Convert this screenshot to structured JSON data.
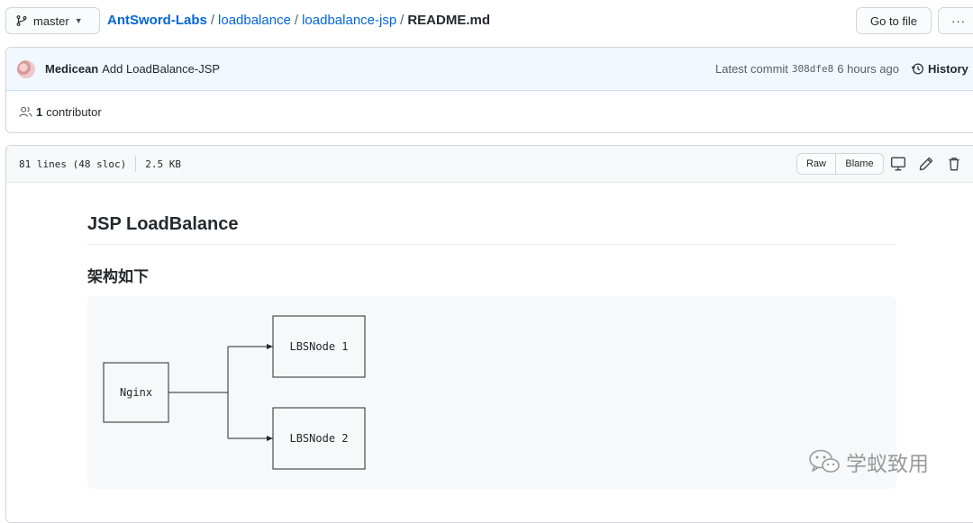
{
  "topbar": {
    "branch": "master",
    "breadcrumb": {
      "owner": "AntSword-Labs",
      "sep1": "/",
      "repo": "loadbalance",
      "sep2": "/",
      "folder": "loadbalance-jsp",
      "sep3": "/",
      "file": "README.md"
    },
    "goto_file": "Go to file",
    "more": "···"
  },
  "commit": {
    "author": "Medicean",
    "message": "Add LoadBalance-JSP",
    "latest_label": "Latest commit",
    "sha": "308dfe8",
    "time": "6 hours ago",
    "history": "History"
  },
  "contributors": {
    "count": "1",
    "label": "contributor"
  },
  "file": {
    "lines": "81 lines (48 sloc)",
    "size": "2.5 KB",
    "raw": "Raw",
    "blame": "Blame"
  },
  "readme": {
    "title": "JSP LoadBalance",
    "subtitle": "架构如下",
    "diagram": {
      "nginx": "Nginx",
      "node1": "LBSNode 1",
      "node2": "LBSNode 2"
    }
  },
  "watermark": "学蚁致用",
  "colors": {
    "link": "#0366d6",
    "commit_bg": "#f1f8ff",
    "header_bg": "#f6f8fa",
    "code_bg": "#f6f8fa"
  },
  "icons": {
    "branch": "git-branch-icon",
    "history": "history-icon",
    "people": "people-icon",
    "desktop": "desktop-icon",
    "edit": "pencil-icon",
    "delete": "trash-icon",
    "wechat": "wechat-icon"
  }
}
